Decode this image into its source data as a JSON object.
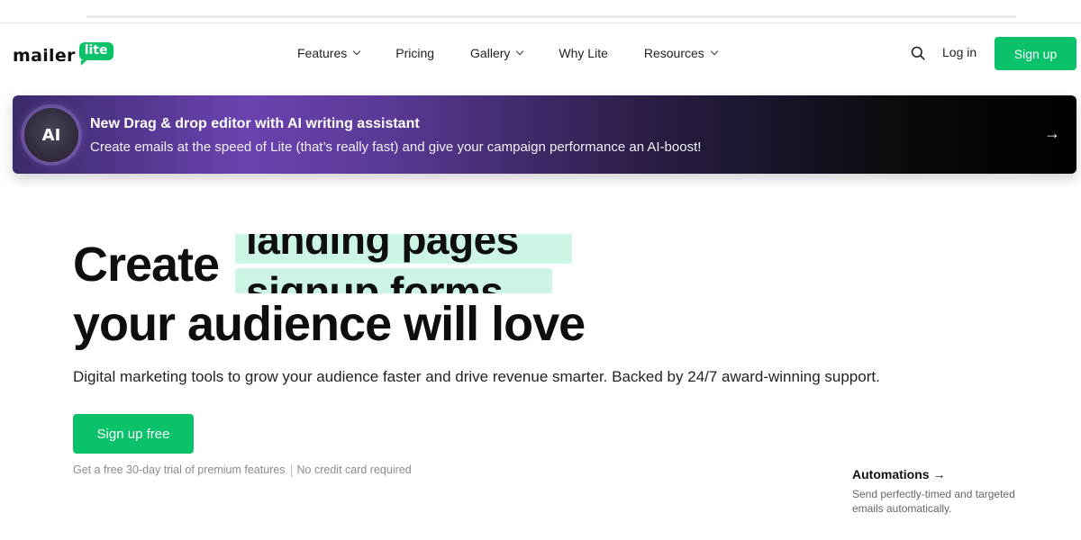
{
  "brand": {
    "word": "mailer",
    "badge": "lite",
    "accent": "#09c269"
  },
  "nav": {
    "items": [
      {
        "label": "Features",
        "dropdown": true
      },
      {
        "label": "Pricing",
        "dropdown": false
      },
      {
        "label": "Gallery",
        "dropdown": true
      },
      {
        "label": "Why Lite",
        "dropdown": false
      },
      {
        "label": "Resources",
        "dropdown": true
      }
    ],
    "login_label": "Log in",
    "signup_label": "Sign up"
  },
  "banner": {
    "badge": "AI",
    "title": "New Drag & drop editor with AI writing assistant",
    "subtitle": "Create emails at the speed of Lite (that’s really fast) and give your campaign performance an AI-boost!",
    "arrow": "→"
  },
  "hero": {
    "heading_start": "Create",
    "rotating_words": [
      "landing pages",
      "signup forms"
    ],
    "heading_end": "your audience will love",
    "description": "Digital marketing tools to grow your audience faster and drive revenue smarter. Backed by 24/7 award-winning support.",
    "cta_label": "Sign up free",
    "trial_note_left": "Get a free 30-day trial of premium features",
    "trial_note_right": "No credit card required"
  },
  "feature_card": {
    "title": "Automations →",
    "description": "Send perfectly-timed and targeted emails automatically."
  }
}
